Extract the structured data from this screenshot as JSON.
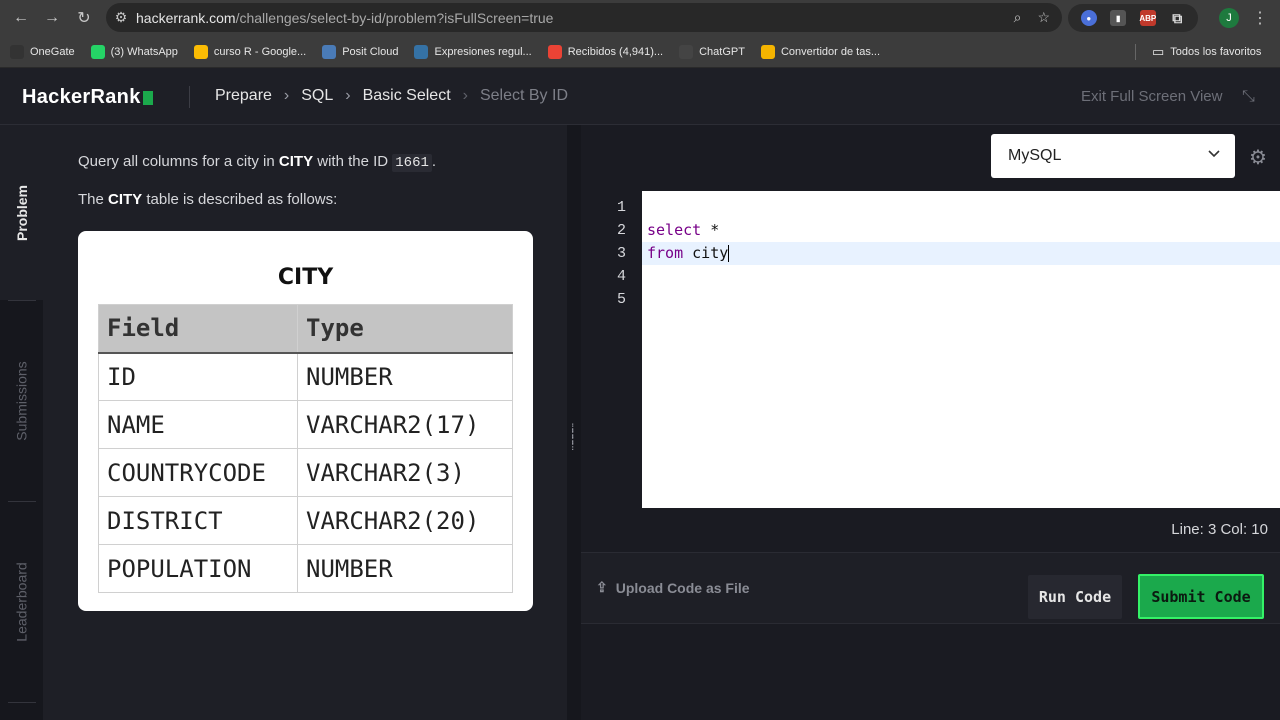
{
  "browser": {
    "url_host": "hackerrank.com",
    "url_path": "/challenges/select-by-id/problem?isFullScreen=true",
    "bookmarks": [
      {
        "label": "OneGate",
        "icon": "onegate-icon",
        "color": "#333333"
      },
      {
        "label": "(3) WhatsApp",
        "icon": "whatsapp-icon",
        "color": "#25d366"
      },
      {
        "label": "curso R - Google...",
        "icon": "google-drive-icon",
        "color": "#fbbc04"
      },
      {
        "label": "Posit Cloud",
        "icon": "posit-cloud-icon",
        "color": "#4a7bb7"
      },
      {
        "label": "Expresiones regul...",
        "icon": "python-icon",
        "color": "#3572a5"
      },
      {
        "label": "Recibidos (4,941)...",
        "icon": "gmail-icon",
        "color": "#ea4335"
      },
      {
        "label": "ChatGPT",
        "icon": "chatgpt-icon",
        "color": "#444444"
      },
      {
        "label": "Convertidor de tas...",
        "icon": "converter-icon",
        "color": "#f4b400"
      }
    ],
    "all_bookmarks_label": "Todos los favoritos",
    "profile_initial": "J"
  },
  "header": {
    "logo": "HackerRank",
    "breadcrumbs": [
      "Prepare",
      "SQL",
      "Basic Select",
      "Select By ID"
    ],
    "exit_fullscreen": "Exit Full Screen View"
  },
  "rail": {
    "tabs": [
      "Problem",
      "Submissions",
      "Leaderboard"
    ]
  },
  "problem": {
    "line1_a": "Query all columns for a city in ",
    "line1_table": "CITY",
    "line1_b": " with the ID ",
    "line1_id": "1661",
    "line1_c": ".",
    "line2_a": "The ",
    "line2_table": "CITY",
    "line2_b": " table is described as follows:",
    "table_title": "CITY",
    "columns": [
      "Field",
      "Type"
    ],
    "rows": [
      [
        "ID",
        "NUMBER"
      ],
      [
        "NAME",
        "VARCHAR2(17)"
      ],
      [
        "COUNTRYCODE",
        "VARCHAR2(3)"
      ],
      [
        "DISTRICT",
        "VARCHAR2(20)"
      ],
      [
        "POPULATION",
        "NUMBER"
      ]
    ]
  },
  "editor": {
    "language": "MySQL",
    "line_numbers": [
      "1",
      "2",
      "3",
      "4",
      "5"
    ],
    "code": {
      "l2_kw": "select",
      "l2_rest": " *",
      "l3_kw": "from",
      "l3_rest": " city"
    },
    "status": "Line: 3 Col: 10",
    "upload_label": "Upload Code as File",
    "run_label": "Run Code",
    "submit_label": "Submit Code"
  }
}
